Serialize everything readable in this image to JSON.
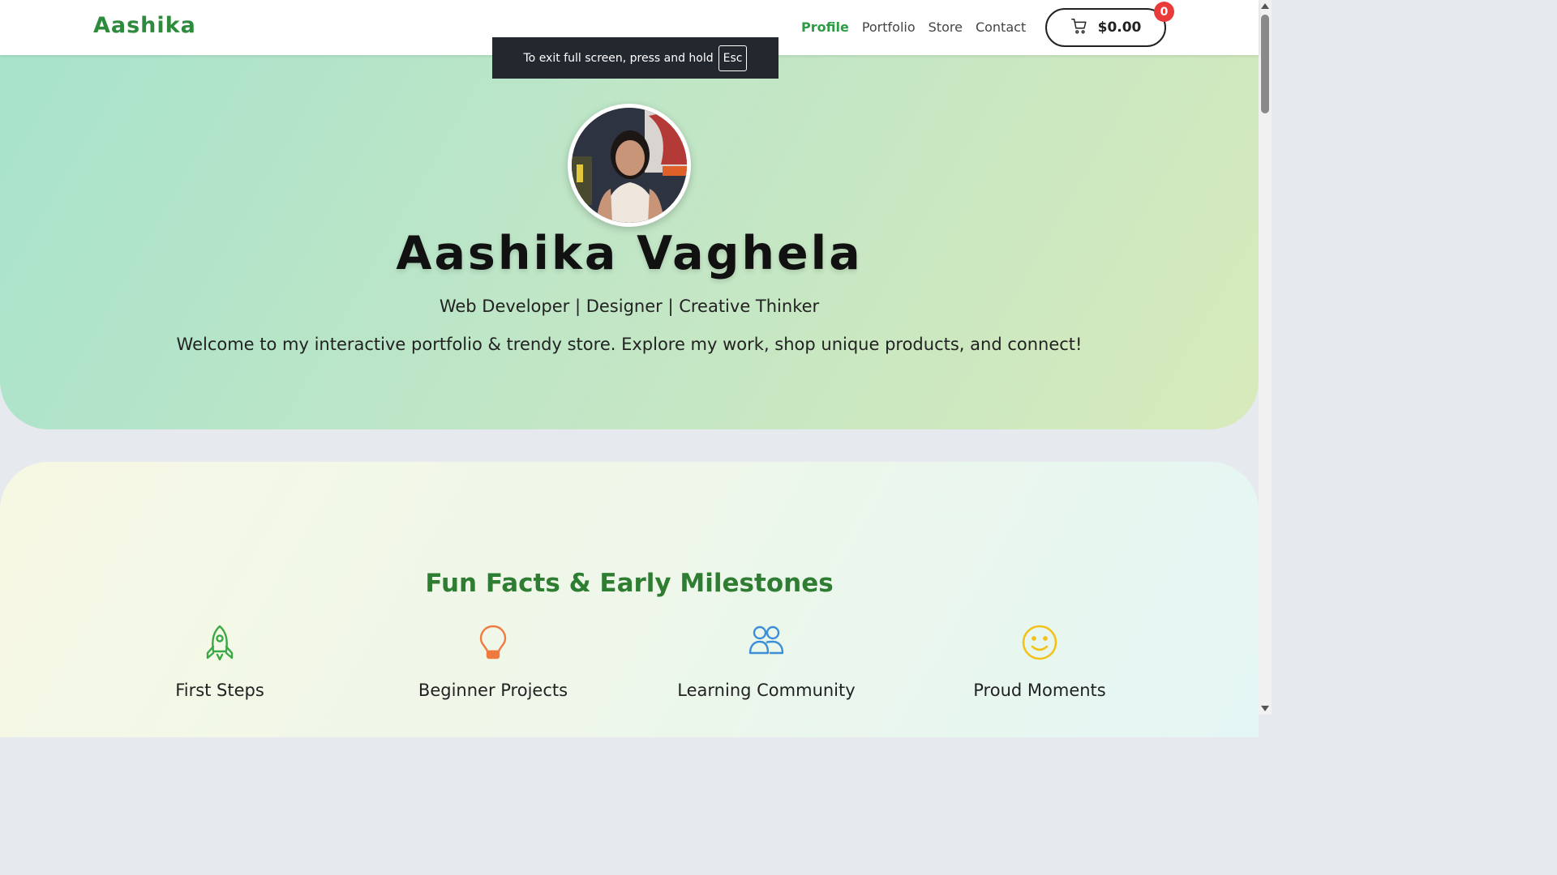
{
  "header": {
    "logo": "Aashika",
    "nav": [
      {
        "label": "Profile",
        "active": true
      },
      {
        "label": "Portfolio",
        "active": false
      },
      {
        "label": "Store",
        "active": false
      },
      {
        "label": "Contact",
        "active": false
      }
    ],
    "cart": {
      "amount": "$0.00",
      "badge_count": "0",
      "icon": "cart-icon"
    }
  },
  "fullscreen_toast": {
    "text": "To exit full screen, press and hold",
    "key": "Esc"
  },
  "hero": {
    "name": "Aashika Vaghela",
    "subtitle": "Web Developer | Designer | Creative Thinker",
    "description": "Welcome to my interactive portfolio & trendy store. Explore my work, shop unique products, and connect!"
  },
  "facts": {
    "title": "Fun Facts & Early Milestones",
    "items": [
      {
        "label": "First Steps",
        "icon": "rocket-icon",
        "color": "#3aa845"
      },
      {
        "label": "Beginner Projects",
        "icon": "lightbulb-icon",
        "color": "#f07a3d"
      },
      {
        "label": "Learning Community",
        "icon": "users-icon",
        "color": "#3b8fd6"
      },
      {
        "label": "Proud Moments",
        "icon": "smile-icon",
        "color": "#f2c21a"
      }
    ]
  },
  "colors": {
    "brand": "#2e8b3e",
    "nav_active": "#2e9c45",
    "badge": "#ea3b3b"
  }
}
